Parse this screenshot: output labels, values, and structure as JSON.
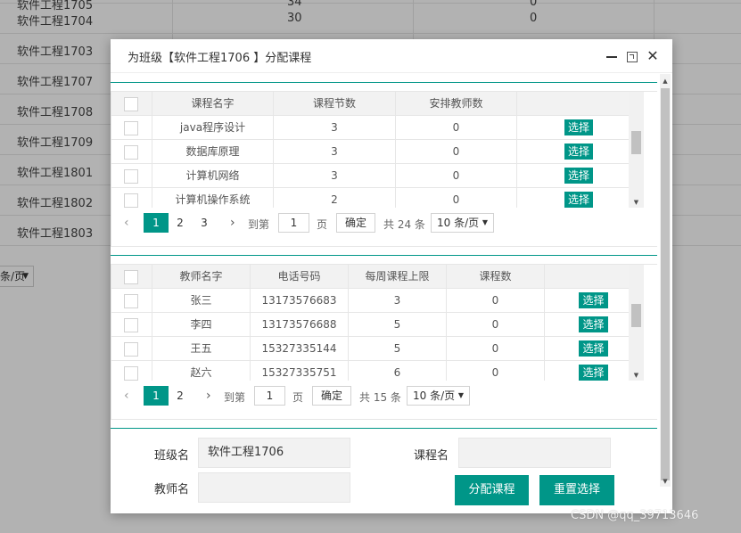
{
  "background": {
    "rows": [
      {
        "name": "软件工程1705",
        "v1": "34",
        "v2": "0"
      },
      {
        "name": "软件工程1704",
        "v1": "30",
        "v2": "0"
      },
      {
        "name": "软件工程1703",
        "v1": "",
        "v2": ""
      },
      {
        "name": "软件工程1707",
        "v1": "",
        "v2": ""
      },
      {
        "name": "软件工程1708",
        "v1": "",
        "v2": ""
      },
      {
        "name": "软件工程1709",
        "v1": "",
        "v2": ""
      },
      {
        "name": "软件工程1801",
        "v1": "",
        "v2": ""
      },
      {
        "name": "软件工程1802",
        "v1": "",
        "v2": ""
      },
      {
        "name": "软件工程1803",
        "v1": "",
        "v2": ""
      }
    ],
    "page_size": "条/页"
  },
  "modal": {
    "title": "为班级【软件工程1706 】分配课程",
    "close_glyph": "✕"
  },
  "courses": {
    "headers": [
      "课程名字",
      "课程节数",
      "安排教师数"
    ],
    "rows": [
      {
        "name": "java程序设计",
        "hours": "3",
        "teachers": "0"
      },
      {
        "name": "数据库原理",
        "hours": "3",
        "teachers": "0"
      },
      {
        "name": "计算机网络",
        "hours": "3",
        "teachers": "0"
      },
      {
        "name": "计算机操作系统",
        "hours": "2",
        "teachers": "0"
      }
    ],
    "select_label": "选择",
    "pager": {
      "prev": "‹",
      "pages": [
        "1",
        "2",
        "3"
      ],
      "next": "›",
      "goto": "到第",
      "page_value": "1",
      "page_unit": "页",
      "confirm": "确定",
      "total": "共 24 条",
      "size": "10 条/页"
    }
  },
  "teachers": {
    "headers": [
      "教师名字",
      "电话号码",
      "每周课程上限",
      "课程数"
    ],
    "rows": [
      {
        "name": "张三",
        "phone": "13173576683",
        "limit": "3",
        "count": "0"
      },
      {
        "name": "李四",
        "phone": "13173576688",
        "limit": "5",
        "count": "0"
      },
      {
        "name": "王五",
        "phone": "15327335144",
        "limit": "5",
        "count": "0"
      },
      {
        "name": "赵六",
        "phone": "15327335751",
        "limit": "6",
        "count": "0"
      }
    ],
    "select_label": "选择",
    "pager": {
      "prev": "‹",
      "pages": [
        "1",
        "2"
      ],
      "next": "›",
      "goto": "到第",
      "page_value": "1",
      "page_unit": "页",
      "confirm": "确定",
      "total": "共 15 条",
      "size": "10 条/页"
    }
  },
  "form": {
    "class_label": "班级名",
    "class_value": "软件工程1706",
    "course_label": "课程名",
    "course_value": "",
    "teacher_label": "教师名",
    "teacher_value": "",
    "assign_button": "分配课程",
    "reset_button": "重置选择"
  },
  "watermark": "CSDN @qq_39713646",
  "colors": {
    "accent": "#009688"
  }
}
